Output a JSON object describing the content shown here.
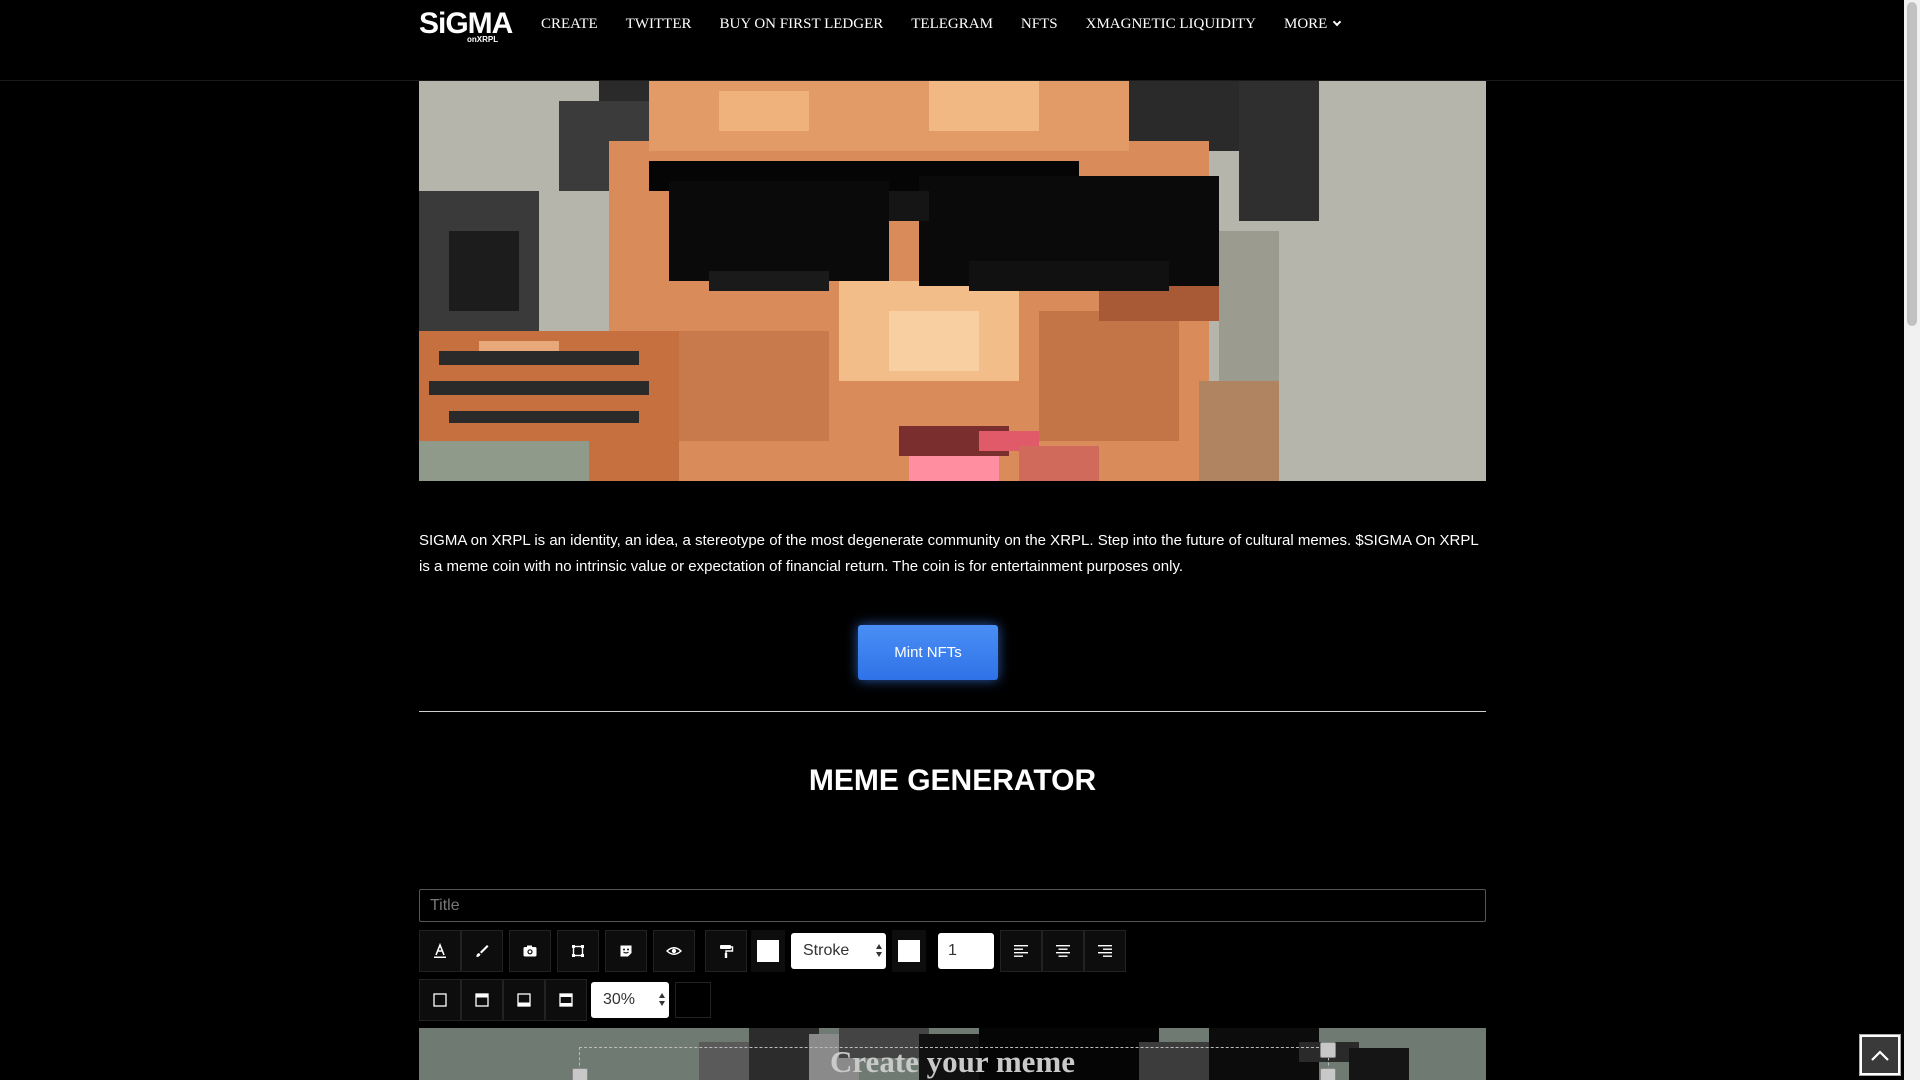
{
  "logo": {
    "main": "SiGMA",
    "sub": "onXRPL"
  },
  "nav": {
    "items": [
      "CREATE",
      "TWITTER",
      "BUY ON FIRST LEDGER",
      "TELEGRAM",
      "NFTS",
      "XMAGNETIC LIQUIDITY"
    ],
    "more_label": "MORE"
  },
  "description": "SIGMA on XRPL is an identity, an idea, a stereotype of the most degenerate community on the XRPL. Step into the future of cultural memes. $SIGMA On XRPL is a meme coin with no intrinsic value or expectation of financial return. The coin is for entertainment purposes only.",
  "mint_button": "Mint NFTs",
  "meme_generator": {
    "heading": "MEME GENERATOR",
    "title_placeholder": "Title",
    "stroke_select": "Stroke",
    "stroke_width": "1",
    "opacity_select": "30%",
    "canvas_text": "Create your meme",
    "icons": {
      "text_color": "text-color-icon",
      "brush": "brush-icon",
      "camera": "camera-icon",
      "crop": "crop-icon",
      "sticker": "sticker-icon",
      "eye": "eye-icon",
      "paint_roller": "paint-roller-icon",
      "align_left": "align-left-icon",
      "align_center": "align-center-icon",
      "align_right": "align-right-icon",
      "frame_none": "frame-none-icon",
      "frame_top": "frame-top-icon",
      "frame_bottom": "frame-bottom-icon",
      "frame_both": "frame-both-icon"
    }
  },
  "colors": {
    "accent": "#3b82f6",
    "background": "#000000"
  }
}
